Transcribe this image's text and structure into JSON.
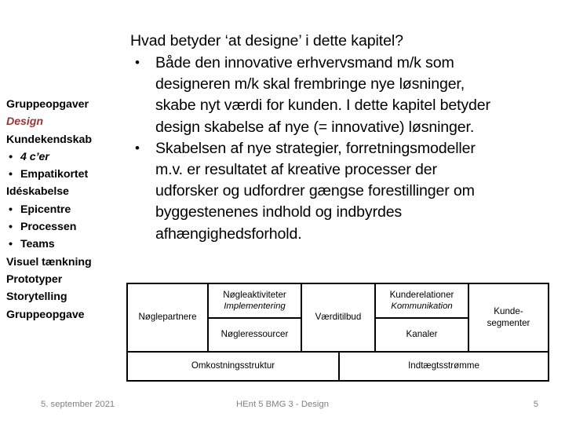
{
  "slide": {
    "sidebar": {
      "items": [
        {
          "label": "Gruppeopgaver",
          "style": "plain"
        },
        {
          "label": "Design",
          "style": "red-italic"
        },
        {
          "label": "Kundekendskab",
          "style": "plain"
        },
        {
          "label": "4 c’er",
          "style": "bullet-italic",
          "bullet": "•"
        },
        {
          "label": "Empatikortet",
          "style": "bullet",
          "bullet": "•"
        },
        {
          "label": "Idéskabelse",
          "style": "plain"
        },
        {
          "label": "Epicentre",
          "style": "bullet",
          "bullet": "•"
        },
        {
          "label": "Processen",
          "style": "bullet",
          "bullet": "•"
        },
        {
          "label": "Teams",
          "style": "bullet",
          "bullet": "•"
        },
        {
          "label": "Visuel tænkning",
          "style": "plain"
        },
        {
          "label": "Prototyper",
          "style": "plain"
        },
        {
          "label": "Storytelling",
          "style": "plain"
        },
        {
          "label": "Gruppeopgave",
          "style": "plain"
        }
      ],
      "accent_color": "#953735"
    },
    "main": {
      "heading": "Hvad betyder ‘at designe’ i dette kapitel?",
      "bullet_glyph": "•",
      "bullets": [
        {
          "lines": [
            "Både den innovative erhvervsmand m/k som",
            "designeren m/k skal frembringe nye løsninger,",
            "skabe nyt værdi for kunden. I dette kapitel betyder",
            "design skabelse af nye (= innovative) løsninger."
          ]
        },
        {
          "lines": [
            "Skabelsen af nye strategier, forretningsmodeller",
            "m.v. er resultatet af kreative processer der",
            "udforsker og udfordrer gængse forestillinger om",
            "byggestenenes indhold og indbyrdes",
            "afhængighedsforhold."
          ]
        }
      ]
    },
    "canvas": {
      "key_partners": "Nøglepartnere",
      "key_activities": "Nøgleaktiviteter",
      "key_activities_sub": "Implementering",
      "key_resources": "Nøgleressourcer",
      "value_proposition": "Værditilbud",
      "customer_relationships": "Kunderelationer",
      "customer_relationships_sub": "Kommunikation",
      "channels": "Kanaler",
      "customer_segments_line1": "Kunde-",
      "customer_segments_line2": "segmenter",
      "cost_structure": "Omkostningsstruktur",
      "revenue_streams": "Indtægtsstrømme"
    },
    "footer": {
      "date": "5. september 2021",
      "center": "HEnt 5 BMG 3 -  Design",
      "page_number": "5",
      "color": "#808080"
    }
  }
}
